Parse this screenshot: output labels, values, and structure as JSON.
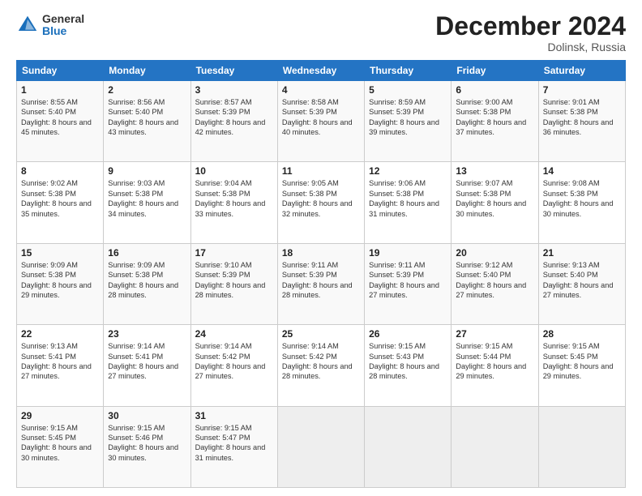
{
  "header": {
    "logo_general": "General",
    "logo_blue": "Blue",
    "month_title": "December 2024",
    "location": "Dolinsk, Russia"
  },
  "days_of_week": [
    "Sunday",
    "Monday",
    "Tuesday",
    "Wednesday",
    "Thursday",
    "Friday",
    "Saturday"
  ],
  "weeks": [
    [
      {
        "day": "1",
        "sunrise": "Sunrise: 8:55 AM",
        "sunset": "Sunset: 5:40 PM",
        "daylight": "Daylight: 8 hours and 45 minutes."
      },
      {
        "day": "2",
        "sunrise": "Sunrise: 8:56 AM",
        "sunset": "Sunset: 5:40 PM",
        "daylight": "Daylight: 8 hours and 43 minutes."
      },
      {
        "day": "3",
        "sunrise": "Sunrise: 8:57 AM",
        "sunset": "Sunset: 5:39 PM",
        "daylight": "Daylight: 8 hours and 42 minutes."
      },
      {
        "day": "4",
        "sunrise": "Sunrise: 8:58 AM",
        "sunset": "Sunset: 5:39 PM",
        "daylight": "Daylight: 8 hours and 40 minutes."
      },
      {
        "day": "5",
        "sunrise": "Sunrise: 8:59 AM",
        "sunset": "Sunset: 5:39 PM",
        "daylight": "Daylight: 8 hours and 39 minutes."
      },
      {
        "day": "6",
        "sunrise": "Sunrise: 9:00 AM",
        "sunset": "Sunset: 5:38 PM",
        "daylight": "Daylight: 8 hours and 37 minutes."
      },
      {
        "day": "7",
        "sunrise": "Sunrise: 9:01 AM",
        "sunset": "Sunset: 5:38 PM",
        "daylight": "Daylight: 8 hours and 36 minutes."
      }
    ],
    [
      {
        "day": "8",
        "sunrise": "Sunrise: 9:02 AM",
        "sunset": "Sunset: 5:38 PM",
        "daylight": "Daylight: 8 hours and 35 minutes."
      },
      {
        "day": "9",
        "sunrise": "Sunrise: 9:03 AM",
        "sunset": "Sunset: 5:38 PM",
        "daylight": "Daylight: 8 hours and 34 minutes."
      },
      {
        "day": "10",
        "sunrise": "Sunrise: 9:04 AM",
        "sunset": "Sunset: 5:38 PM",
        "daylight": "Daylight: 8 hours and 33 minutes."
      },
      {
        "day": "11",
        "sunrise": "Sunrise: 9:05 AM",
        "sunset": "Sunset: 5:38 PM",
        "daylight": "Daylight: 8 hours and 32 minutes."
      },
      {
        "day": "12",
        "sunrise": "Sunrise: 9:06 AM",
        "sunset": "Sunset: 5:38 PM",
        "daylight": "Daylight: 8 hours and 31 minutes."
      },
      {
        "day": "13",
        "sunrise": "Sunrise: 9:07 AM",
        "sunset": "Sunset: 5:38 PM",
        "daylight": "Daylight: 8 hours and 30 minutes."
      },
      {
        "day": "14",
        "sunrise": "Sunrise: 9:08 AM",
        "sunset": "Sunset: 5:38 PM",
        "daylight": "Daylight: 8 hours and 30 minutes."
      }
    ],
    [
      {
        "day": "15",
        "sunrise": "Sunrise: 9:09 AM",
        "sunset": "Sunset: 5:38 PM",
        "daylight": "Daylight: 8 hours and 29 minutes."
      },
      {
        "day": "16",
        "sunrise": "Sunrise: 9:09 AM",
        "sunset": "Sunset: 5:38 PM",
        "daylight": "Daylight: 8 hours and 28 minutes."
      },
      {
        "day": "17",
        "sunrise": "Sunrise: 9:10 AM",
        "sunset": "Sunset: 5:39 PM",
        "daylight": "Daylight: 8 hours and 28 minutes."
      },
      {
        "day": "18",
        "sunrise": "Sunrise: 9:11 AM",
        "sunset": "Sunset: 5:39 PM",
        "daylight": "Daylight: 8 hours and 28 minutes."
      },
      {
        "day": "19",
        "sunrise": "Sunrise: 9:11 AM",
        "sunset": "Sunset: 5:39 PM",
        "daylight": "Daylight: 8 hours and 27 minutes."
      },
      {
        "day": "20",
        "sunrise": "Sunrise: 9:12 AM",
        "sunset": "Sunset: 5:40 PM",
        "daylight": "Daylight: 8 hours and 27 minutes."
      },
      {
        "day": "21",
        "sunrise": "Sunrise: 9:13 AM",
        "sunset": "Sunset: 5:40 PM",
        "daylight": "Daylight: 8 hours and 27 minutes."
      }
    ],
    [
      {
        "day": "22",
        "sunrise": "Sunrise: 9:13 AM",
        "sunset": "Sunset: 5:41 PM",
        "daylight": "Daylight: 8 hours and 27 minutes."
      },
      {
        "day": "23",
        "sunrise": "Sunrise: 9:14 AM",
        "sunset": "Sunset: 5:41 PM",
        "daylight": "Daylight: 8 hours and 27 minutes."
      },
      {
        "day": "24",
        "sunrise": "Sunrise: 9:14 AM",
        "sunset": "Sunset: 5:42 PM",
        "daylight": "Daylight: 8 hours and 27 minutes."
      },
      {
        "day": "25",
        "sunrise": "Sunrise: 9:14 AM",
        "sunset": "Sunset: 5:42 PM",
        "daylight": "Daylight: 8 hours and 28 minutes."
      },
      {
        "day": "26",
        "sunrise": "Sunrise: 9:15 AM",
        "sunset": "Sunset: 5:43 PM",
        "daylight": "Daylight: 8 hours and 28 minutes."
      },
      {
        "day": "27",
        "sunrise": "Sunrise: 9:15 AM",
        "sunset": "Sunset: 5:44 PM",
        "daylight": "Daylight: 8 hours and 29 minutes."
      },
      {
        "day": "28",
        "sunrise": "Sunrise: 9:15 AM",
        "sunset": "Sunset: 5:45 PM",
        "daylight": "Daylight: 8 hours and 29 minutes."
      }
    ],
    [
      {
        "day": "29",
        "sunrise": "Sunrise: 9:15 AM",
        "sunset": "Sunset: 5:45 PM",
        "daylight": "Daylight: 8 hours and 30 minutes."
      },
      {
        "day": "30",
        "sunrise": "Sunrise: 9:15 AM",
        "sunset": "Sunset: 5:46 PM",
        "daylight": "Daylight: 8 hours and 30 minutes."
      },
      {
        "day": "31",
        "sunrise": "Sunrise: 9:15 AM",
        "sunset": "Sunset: 5:47 PM",
        "daylight": "Daylight: 8 hours and 31 minutes."
      },
      null,
      null,
      null,
      null
    ]
  ]
}
